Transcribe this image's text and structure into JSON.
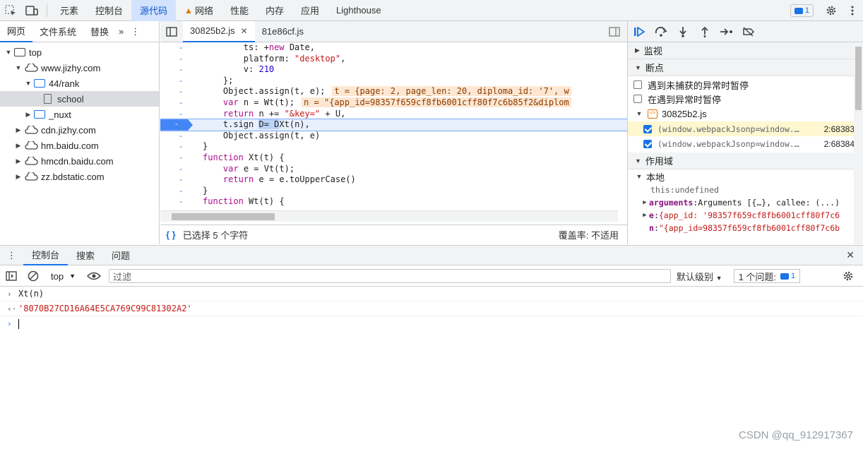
{
  "top_tabs": [
    "元素",
    "控制台",
    "源代码",
    "网络",
    "性能",
    "内存",
    "应用",
    "Lighthouse"
  ],
  "top_active": "源代码",
  "issues_badge": "1",
  "nav": {
    "tabs": [
      "网页",
      "文件系统",
      "替换"
    ],
    "tree": {
      "top": "top",
      "site": "www.jizhy.com",
      "folder": "44/rank",
      "file": "school",
      "nuxt": "_nuxt",
      "domains": [
        "cdn.jizhy.com",
        "hm.baidu.com",
        "hmcdn.baidu.com",
        "zz.bdstatic.com"
      ]
    }
  },
  "editor": {
    "tabs": [
      "30825b2.js",
      "81e86cf.js"
    ],
    "gutter": "-",
    "lines": {
      "l1a": "        ts: +",
      "l1kw": "new",
      "l1b": " Date,",
      "l2a": "        platform: ",
      "l2s": "\"desktop\"",
      "l2b": ",",
      "l3a": "        v: ",
      "l3n": "210",
      "l4": "    };",
      "l5": "    Object.assign(t, e);",
      "l5inl": "t = {page: 2, page_len: 20, diploma_id: '7', w",
      "l6kw": "var",
      "l6b": " n = Wt(t);",
      "l6inl": "n = \"{app_id=98357f659cf8fb6001cff80f7c6b85f2&diplom",
      "l7kw": "return",
      "l7b": " n += ",
      "l7s": "\"&key=\"",
      "l7c": " + U,",
      "l8a": "    t.sign ",
      "l8s1": "D= ",
      "l8s2": "D",
      "l8b": "Xt(n),",
      "l9": "    Object.assign(t, e)",
      "l10": "}",
      "l11kw": "function",
      "l11b": " Xt(t) {",
      "l12kw": "var",
      "l12b": " e = Vt(t);",
      "l13kw": "return",
      "l13b": " e = e.toUpperCase()",
      "l14": "}",
      "l15kw": "function",
      "l15b": " Wt(t) {"
    },
    "status_selected": "已选择 5 个字符",
    "status_coverage": "覆盖率: 不适用"
  },
  "debugger": {
    "watch": "监视",
    "breakpoints": "断点",
    "pause_uncaught": "遇到未捕获的异常时暂停",
    "pause_caught": "在遇到异常时暂停",
    "bp_file": "30825b2.js",
    "bps": [
      {
        "code": "(window.webpackJsonp=window.webpackJsonp||[])",
        "loc": "2:68383"
      },
      {
        "code": "(window.webpackJsonp=window.webpackJsonp||[])",
        "loc": "2:68384"
      }
    ],
    "scope": "作用域",
    "local": "本地",
    "this_name": "this",
    "this_val": "undefined",
    "args_name": "arguments",
    "args_val": "Arguments [{…}, callee: (...)",
    "e_name": "e",
    "e_val": "{app_id: '98357f659cf8fb6001cff80f7c6",
    "n_name": "n",
    "n_val": "\"{app_id=98357f659cf8fb6001cff80f7c6b"
  },
  "drawer": {
    "tabs": [
      "控制台",
      "搜索",
      "问题"
    ],
    "context": "top",
    "filter_placeholder": "过滤",
    "levels": "默认级别",
    "issues": "1 个问题:",
    "issues_count": "1"
  },
  "console": {
    "input1": "Xt(n)",
    "result1": "'8070B27CD16A64E5CA769C99C81302A2'"
  },
  "watermark": "CSDN @qq_912917367"
}
